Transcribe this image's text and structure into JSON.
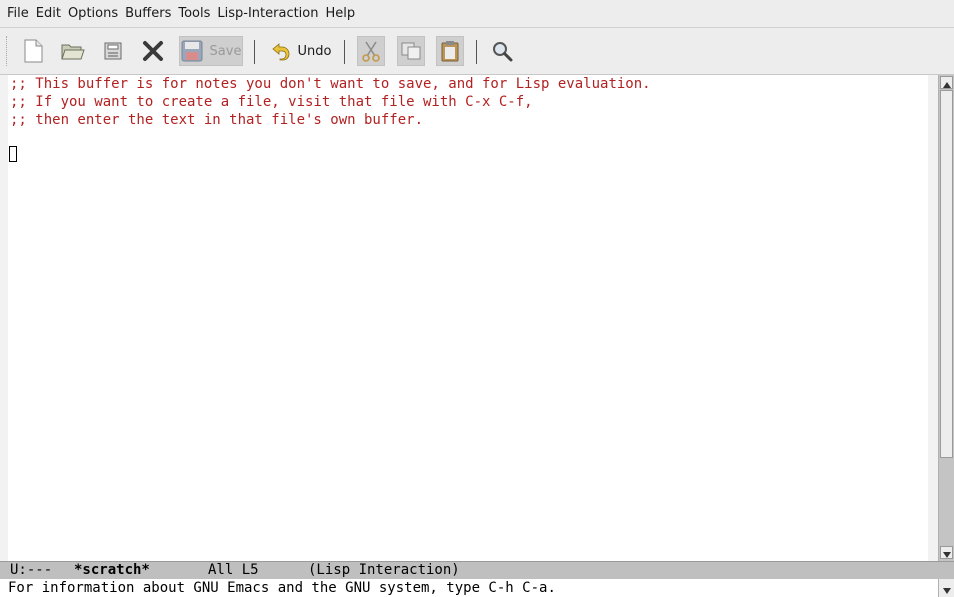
{
  "menu": {
    "items": [
      "File",
      "Edit",
      "Options",
      "Buffers",
      "Tools",
      "Lisp-Interaction",
      "Help"
    ]
  },
  "toolbar": {
    "new_file": "new-file-icon",
    "open_file": "open-folder-icon",
    "dired": "dired-icon",
    "kill_buffer": "close-icon",
    "save_label": "Save",
    "undo_label": "Undo",
    "cut": "cut-icon",
    "copy": "copy-icon",
    "paste": "paste-icon",
    "search": "search-icon"
  },
  "buffer": {
    "lines": [
      ";; This buffer is for notes you don't want to save, and for Lisp evaluation.",
      ";; If you want to create a file, visit that file with C-x C-f,",
      ";; then enter the text in that file's own buffer."
    ],
    "comment_color": "#b22222"
  },
  "modeline": {
    "status": "U:---",
    "buffer_name": "*scratch*",
    "position": "All L5",
    "mode": "(Lisp Interaction)"
  },
  "echo": {
    "message": "For information about GNU Emacs and the GNU system, type C-h C-a."
  }
}
